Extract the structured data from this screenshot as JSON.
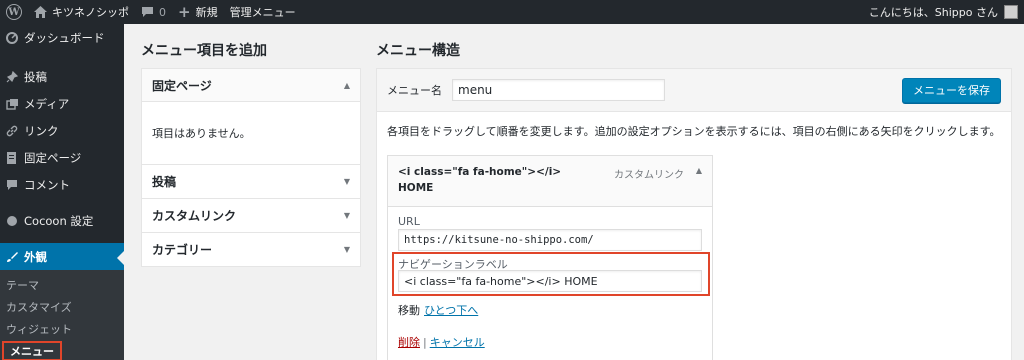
{
  "adminbar": {
    "site_name": "キツネノシッポ",
    "comments_count": "0",
    "new_label": "新規",
    "admin_menu_label": "管理メニュー",
    "greeting": "こんにちは、Shippo さん"
  },
  "sidebar": {
    "items": [
      {
        "label": "ダッシュボード",
        "icon": "dashboard-icon"
      },
      {
        "label": "投稿",
        "icon": "pin-icon"
      },
      {
        "label": "メディア",
        "icon": "media-icon"
      },
      {
        "label": "リンク",
        "icon": "link-icon"
      },
      {
        "label": "固定ページ",
        "icon": "page-icon"
      },
      {
        "label": "コメント",
        "icon": "comment-icon"
      },
      {
        "label": "Cocoon 設定",
        "icon": "circle-icon"
      },
      {
        "label": "外観",
        "icon": "brush-icon"
      }
    ],
    "submenu": [
      "テーマ",
      "カスタマイズ",
      "ウィジェット",
      "メニュー"
    ]
  },
  "left_column": {
    "title": "メニュー項目を追加",
    "pages_section": "固定ページ",
    "pages_empty": "項目はありません。",
    "sections": [
      "投稿",
      "カスタムリンク",
      "カテゴリー"
    ]
  },
  "right_column": {
    "title": "メニュー構造",
    "menu_name_label": "メニュー名",
    "menu_name_value": "menu",
    "save_button": "メニューを保存",
    "instructions": "各項目をドラッグして順番を変更します。追加の設定オプションを表示するには、項目の右側にある矢印をクリックします。",
    "item": {
      "title_line1": "<i class=\"fa fa-home\"></i>",
      "title_line2": "HOME",
      "type": "カスタムリンク",
      "url_label": "URL",
      "url_value": "https://kitsune-no-shippo.com/",
      "nav_label_label": "ナビゲーションラベル",
      "nav_label_value": "<i class=\"fa fa-home\"></i> HOME",
      "move_label": "移動",
      "move_link": "ひとつ下へ",
      "delete_link": "削除",
      "separator": "|",
      "cancel_link": "キャンセル"
    }
  },
  "colors": {
    "admin_bg": "#23282d",
    "accent": "#0073aa",
    "save_button": "#0085ba",
    "highlight": "#e0452a",
    "delete": "#aa0000"
  }
}
